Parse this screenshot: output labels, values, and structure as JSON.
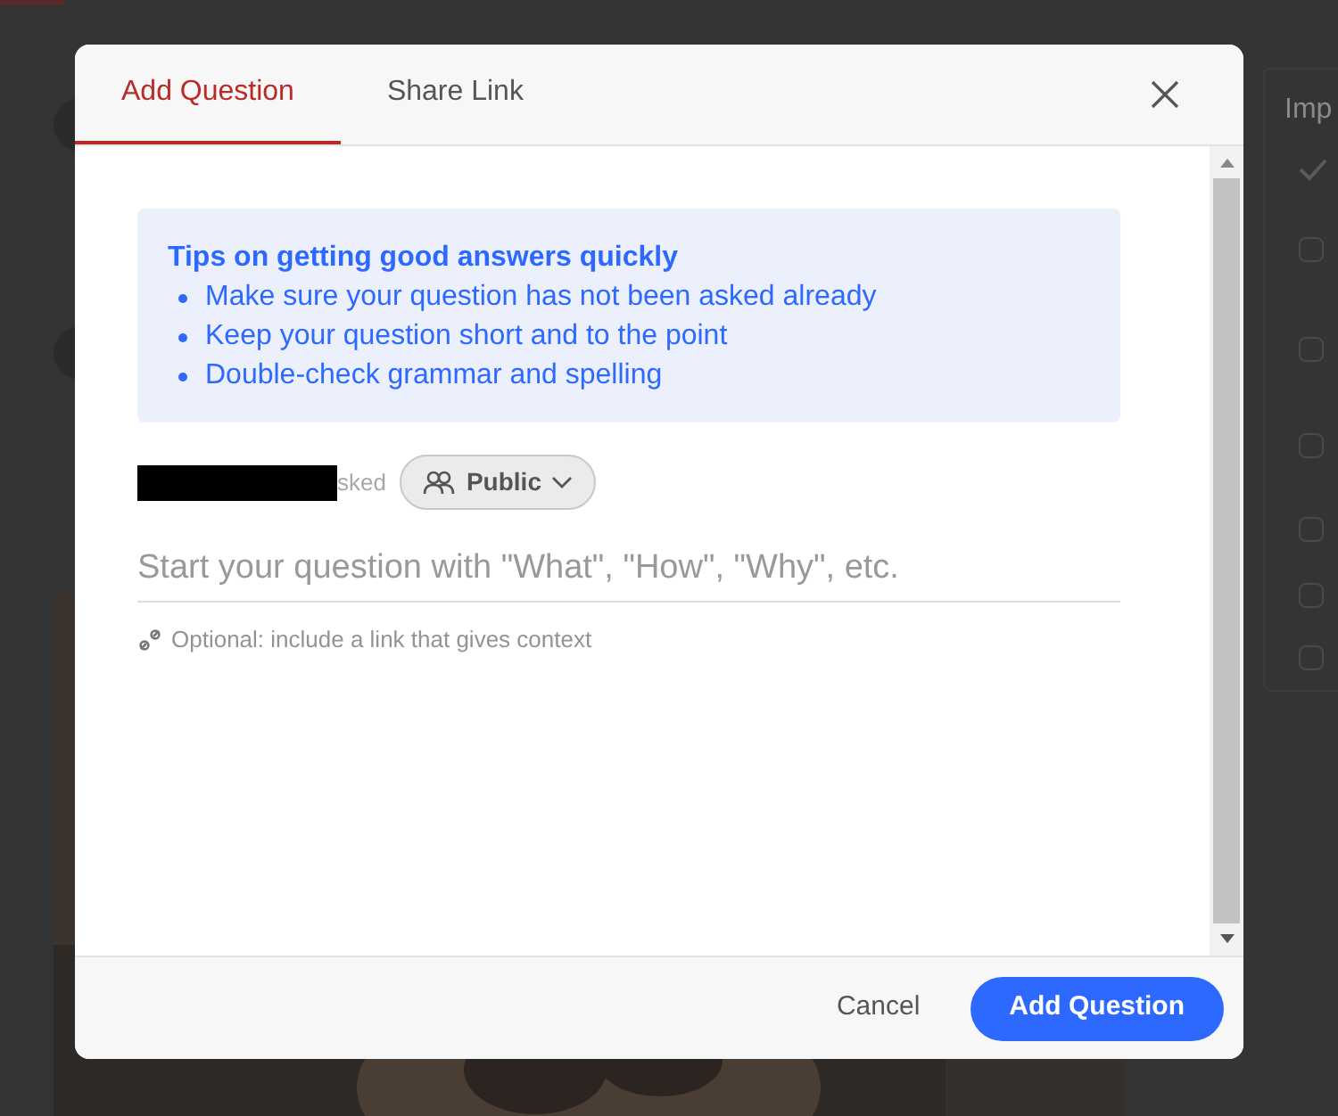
{
  "background": {
    "side_table": {
      "column": "Imp",
      "rows": [
        {
          "checked": true
        },
        {
          "checked": false
        },
        {
          "checked": false
        },
        {
          "checked": false
        },
        {
          "checked": false
        },
        {
          "checked": false
        },
        {
          "checked": false
        }
      ]
    }
  },
  "dialog": {
    "tabs": [
      {
        "label": "Add Question",
        "selected": true
      },
      {
        "label": "Share Link",
        "selected": false
      }
    ],
    "tips": {
      "title": "Tips on getting good answers quickly",
      "items": [
        "Make sure your question has not been asked already",
        "Keep your question short and to the point",
        "Double-check grammar and spelling"
      ]
    },
    "author": {
      "redacted": true,
      "suffix": "sked"
    },
    "audience": "Public",
    "question": {
      "placeholder": "Start your question with \"What\", \"How\", \"Why\", etc."
    },
    "link_hint": "Optional: include a link that gives context",
    "buttons": [
      {
        "label": "Cancel",
        "kind": "secondary"
      },
      {
        "label": "Add Question",
        "kind": "primary"
      }
    ]
  }
}
